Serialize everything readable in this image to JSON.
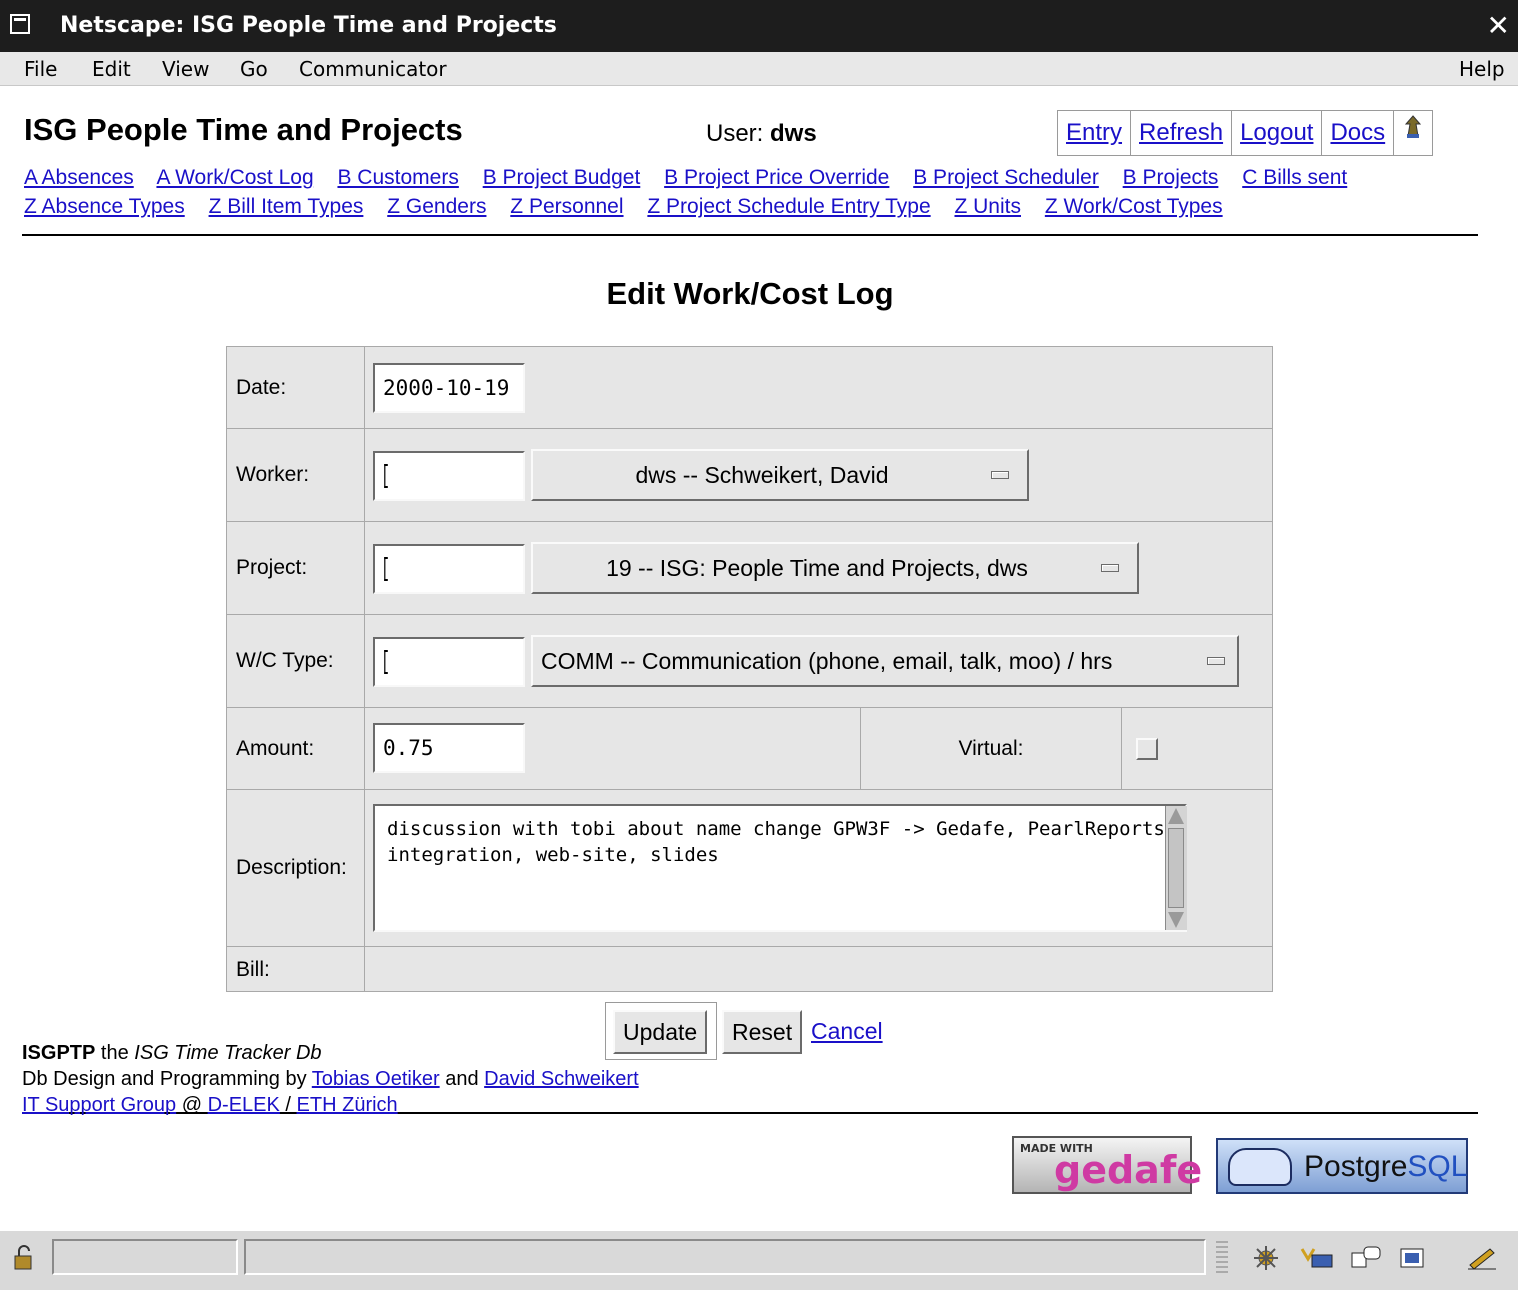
{
  "window": {
    "title": "Netscape: ISG People Time and Projects",
    "close": "✕"
  },
  "menu": {
    "file": "File",
    "edit": "Edit",
    "view": "View",
    "go": "Go",
    "communicator": "Communicator",
    "help": "Help"
  },
  "header": {
    "app_title": "ISG People Time and Projects",
    "user_label": "User:",
    "user_name": "dws",
    "nav": [
      "Entry",
      "Refresh",
      "Logout",
      "Docs"
    ]
  },
  "tables_row1": [
    "A Absences",
    "A Work/Cost Log",
    "B Customers",
    "B Project Budget",
    "B Project Price Override",
    "B Project Scheduler",
    "B Projects",
    "C Bills sent"
  ],
  "tables_row2": [
    "Z Absence Types",
    "Z Bill Item Types",
    "Z Genders",
    "Z Personnel",
    "Z Project Schedule Entry Type",
    "Z Units",
    "Z Work/Cost Types"
  ],
  "form": {
    "title": "Edit Work/Cost Log",
    "date_label": "Date:",
    "date_value": "2000-10-19",
    "worker_label": "Worker:",
    "worker_select": "dws -- Schweikert, David",
    "project_label": "Project:",
    "project_select": "19 -- ISG: People Time and Projects, dws",
    "wctype_label": "W/C Type:",
    "wctype_select": "COMM -- Communication (phone, email, talk, moo) / hrs",
    "amount_label": "Amount:",
    "amount_value": "0.75",
    "virtual_label": "Virtual:",
    "description_label": "Description:",
    "description_value": "discussion with tobi about name change GPW3F -> Gedafe, PearlReports integration, web-site, slides",
    "bill_label": "Bill:",
    "update": "Update",
    "reset": "Reset",
    "cancel": "Cancel"
  },
  "footer": {
    "app_abbr": "ISGPTP",
    "the": "the",
    "app_full": "ISG Time Tracker Db",
    "design_by": "Db Design and Programming by",
    "author1": "Tobias Oetiker",
    "and": "and",
    "author2": "David Schweikert",
    "group": "IT Support Group",
    "at": "@",
    "dept": "D-ELEK",
    "slash": "/",
    "uni": "ETH Zürich",
    "made_with": "MADE WITH",
    "gedafe": "gedafe",
    "pg_a": "Postgre",
    "pg_b": "SQL"
  }
}
